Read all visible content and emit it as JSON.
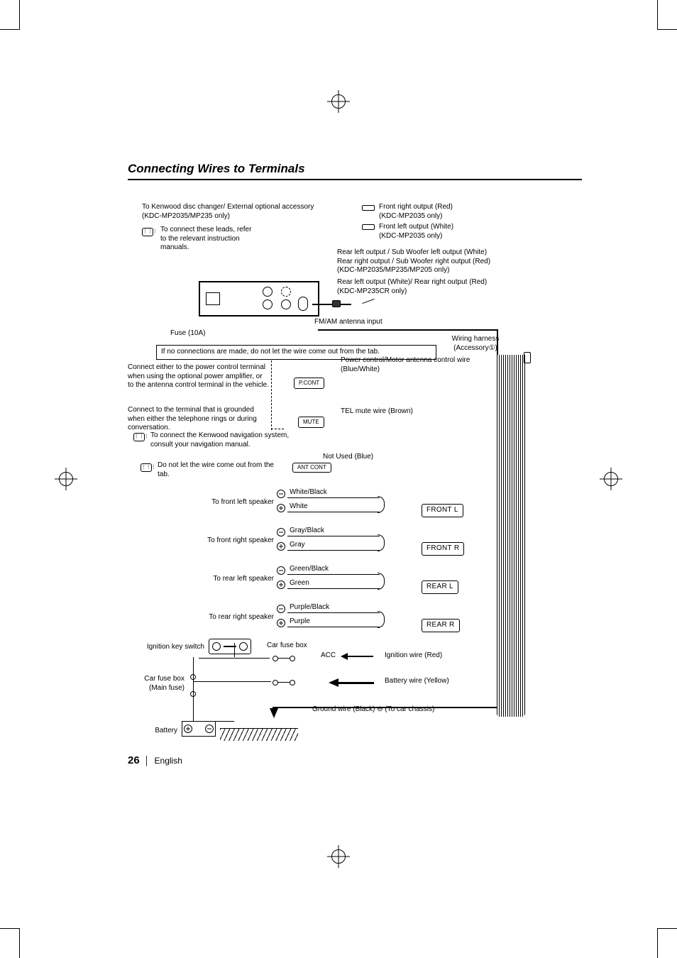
{
  "page": {
    "number": "26",
    "lang": "English"
  },
  "title": "Connecting Wires to Terminals",
  "top": {
    "disc_changer": "To Kenwood disc changer/ External optional accessory",
    "disc_changer_models": "(KDC-MP2035/MP235 only)",
    "connect_leads": "To connect these leads, refer to the relevant instruction manuals.",
    "fuse": "Fuse (10A)",
    "front_right": "Front right output (Red)",
    "front_right_models": "(KDC-MP2035 only)",
    "front_left": "Front left output (White)",
    "front_left_models": "(KDC-MP2035 only)",
    "rear_left_sub": "Rear left output / Sub Woofer left output (White)",
    "rear_right_sub": "Rear right output / Sub Woofer right output (Red)",
    "rear_sub_models": "(KDC-MP2035/MP235/MP205 only)",
    "rear_cr": "Rear left output (White)/ Rear right output (Red)",
    "rear_cr_models": "(KDC-MP235CR only)",
    "antenna": "FM/AM antenna input"
  },
  "harness": {
    "title1": "Wiring harness",
    "title2": "(Accessory①)",
    "tab_note": "If no connections are made, do not let the wire come out from the tab.",
    "power_note": "Connect either to the power control terminal when using the optional power amplifier, or to the antenna control terminal in the vehicle.",
    "power_wire": "Power control/Motor antenna control wire (Blue/White)",
    "pcont": "P.CONT",
    "tel_note": "Connect to the terminal that is grounded when either the telephone rings or during conversation.",
    "tel_wire": "TEL mute wire (Brown)",
    "mute": "MUTE",
    "nav_note": "To connect the Kenwood navigation system, consult your navigation manual.",
    "notused": "Not Used (Blue)",
    "antcont": "ANT CONT",
    "tab_note2": "Do not let the wire come out from the tab."
  },
  "speakers": {
    "fl": {
      "label": "To front left speaker",
      "neg": "White/Black",
      "pos": "White",
      "tag": "FRONT  L"
    },
    "fr": {
      "label": "To front right speaker",
      "neg": "Gray/Black",
      "pos": "Gray",
      "tag": "FRONT  R"
    },
    "rl": {
      "label": "To rear left speaker",
      "neg": "Green/Black",
      "pos": "Green",
      "tag": "REAR  L"
    },
    "rr": {
      "label": "To rear right speaker",
      "neg": "Purple/Black",
      "pos": "Purple",
      "tag": "REAR  R"
    }
  },
  "power": {
    "ign_switch": "Ignition key switch",
    "car_fuse": "Car fuse box",
    "car_fuse_main": "Car fuse box (Main fuse)",
    "battery": "Battery",
    "acc": "ACC",
    "ign_wire": "Ignition wire (Red)",
    "batt_wire": "Battery wire (Yellow)",
    "gnd": "Ground wire (Black) ⊖ (To car chassis)"
  }
}
